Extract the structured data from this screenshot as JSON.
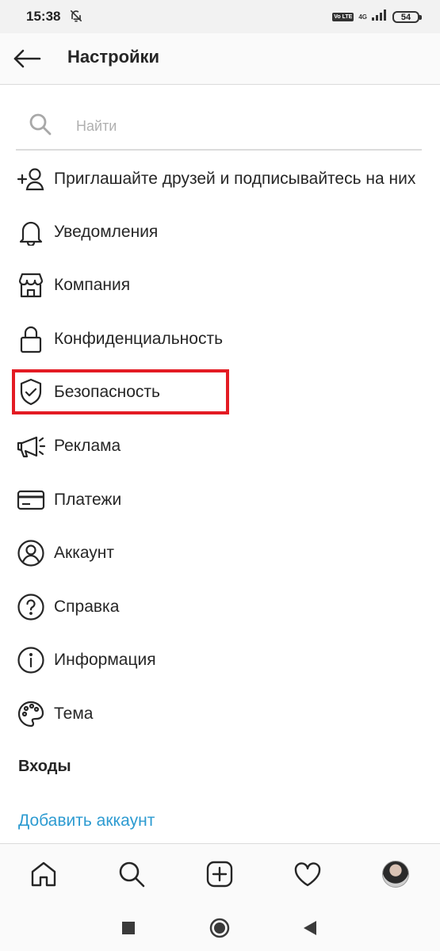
{
  "status_bar": {
    "time": "15:38",
    "network": "4G",
    "volte": "Vo LTE",
    "battery": "54"
  },
  "header": {
    "title": "Настройки"
  },
  "search": {
    "placeholder": "Найти",
    "value": ""
  },
  "menu": [
    {
      "label": "Приглашайте друзей и подписывайтесь на них",
      "icon": "add-user-icon"
    },
    {
      "label": "Уведомления",
      "icon": "bell-icon"
    },
    {
      "label": "Компания",
      "icon": "shop-icon"
    },
    {
      "label": "Конфиденциальность",
      "icon": "lock-icon"
    },
    {
      "label": "Безопасность",
      "icon": "shield-check-icon",
      "highlighted": true
    },
    {
      "label": "Реклама",
      "icon": "megaphone-icon"
    },
    {
      "label": "Платежи",
      "icon": "card-icon"
    },
    {
      "label": "Аккаунт",
      "icon": "account-icon"
    },
    {
      "label": "Справка",
      "icon": "help-icon"
    },
    {
      "label": "Информация",
      "icon": "info-icon"
    },
    {
      "label": "Тема",
      "icon": "palette-icon"
    }
  ],
  "logins": {
    "title": "Входы",
    "add_account": "Добавить аккаунт"
  },
  "bottom_nav": [
    "home-icon",
    "search-icon",
    "add-post-icon",
    "heart-icon",
    "profile-avatar"
  ],
  "system_nav": [
    "recents-button",
    "home-button",
    "back-button"
  ],
  "colors": {
    "accent_link": "#2d9bd1",
    "highlight_border": "#e31b23",
    "text": "#262626"
  }
}
